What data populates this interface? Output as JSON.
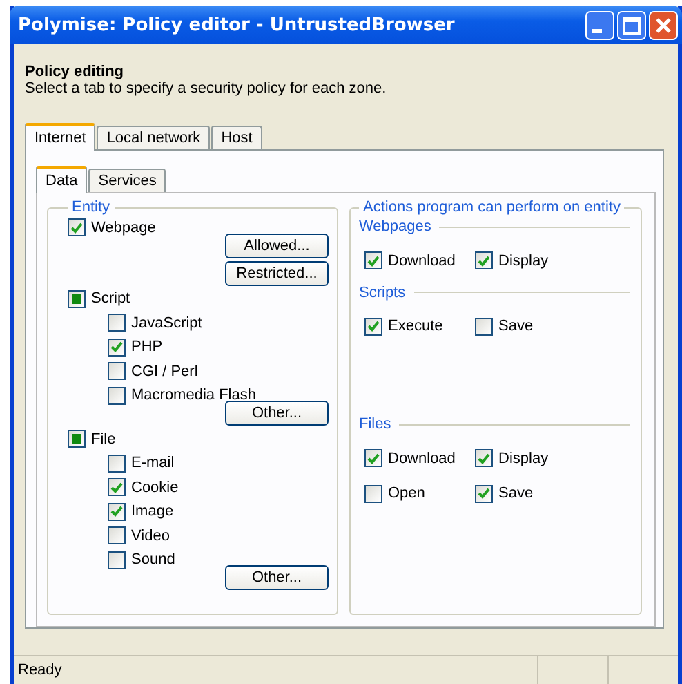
{
  "window": {
    "title": "Polymise: Policy editor - UntrustedBrowser"
  },
  "header": {
    "title": "Policy editing",
    "subtitle": "Select a tab to specify a security policy for each zone."
  },
  "zone_tabs": [
    {
      "label": "Internet",
      "selected": true
    },
    {
      "label": "Local network",
      "selected": false
    },
    {
      "label": "Host",
      "selected": false
    }
  ],
  "sub_tabs": [
    {
      "label": "Data",
      "selected": true
    },
    {
      "label": "Services",
      "selected": false
    }
  ],
  "entity": {
    "title": "Entity",
    "items": [
      {
        "label": "Webpage",
        "checked": true,
        "indeterminate": false,
        "buttons": [
          "Allowed...",
          "Restricted..."
        ]
      },
      {
        "label": "Script",
        "checked": false,
        "indeterminate": true,
        "children": [
          {
            "label": "JavaScript",
            "checked": false
          },
          {
            "label": "PHP",
            "checked": true
          },
          {
            "label": "CGI / Perl",
            "checked": false
          },
          {
            "label": "Macromedia Flash",
            "checked": false
          }
        ],
        "buttons": [
          "Other..."
        ]
      },
      {
        "label": "File",
        "checked": false,
        "indeterminate": true,
        "children": [
          {
            "label": "E-mail",
            "checked": false
          },
          {
            "label": "Cookie",
            "checked": true
          },
          {
            "label": "Image",
            "checked": true
          },
          {
            "label": "Video",
            "checked": false
          },
          {
            "label": "Sound",
            "checked": false
          }
        ],
        "buttons": [
          "Other..."
        ]
      }
    ]
  },
  "actions": {
    "title": "Actions program can perform on entity",
    "sections": [
      {
        "title": "Webpages",
        "options": [
          {
            "label": "Download",
            "checked": true
          },
          {
            "label": "Display",
            "checked": true
          }
        ]
      },
      {
        "title": "Scripts",
        "options": [
          {
            "label": "Execute",
            "checked": true
          },
          {
            "label": "Save",
            "checked": false
          }
        ]
      },
      {
        "title": "Files",
        "options": [
          {
            "label": "Download",
            "checked": true
          },
          {
            "label": "Display",
            "checked": true
          },
          {
            "label": "Open",
            "checked": false
          },
          {
            "label": "Save",
            "checked": true
          }
        ]
      }
    ]
  },
  "status_bar": {
    "text": "Ready"
  }
}
